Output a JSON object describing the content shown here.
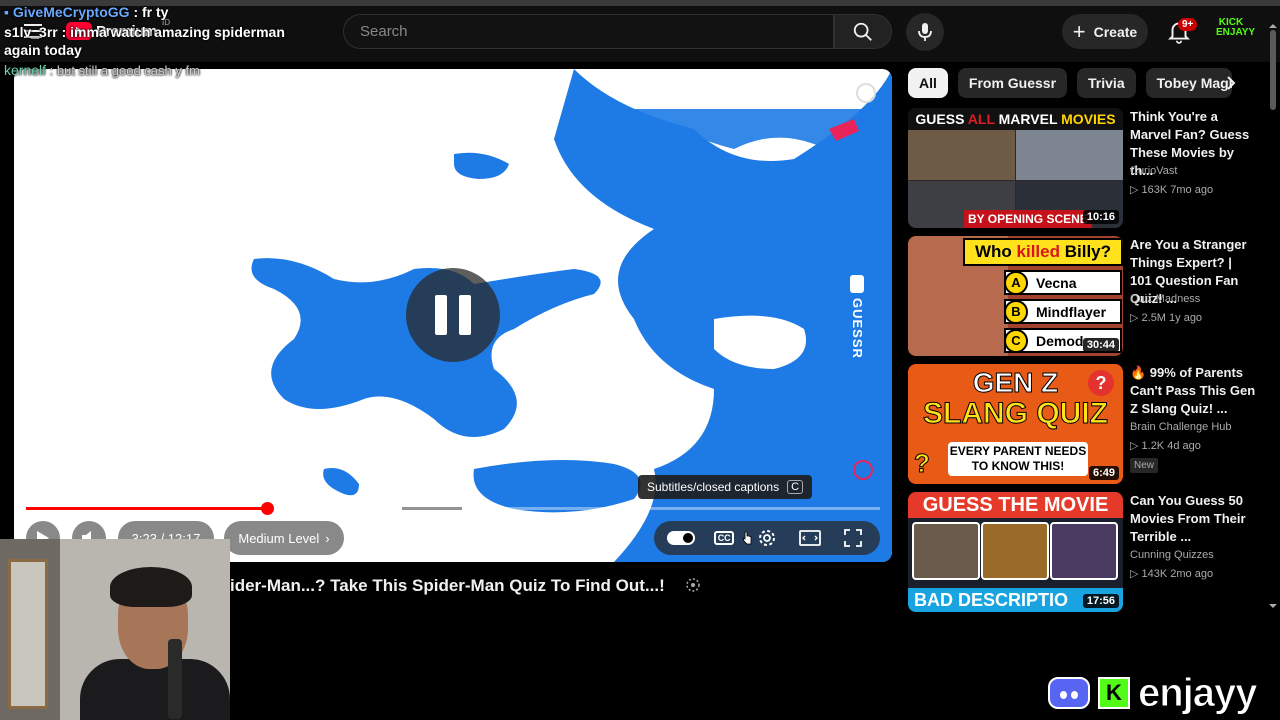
{
  "header": {
    "logo_text": "Premium",
    "logo_sup": "ID",
    "search_placeholder": "Search",
    "create_label": "Create",
    "notification_count": "9+",
    "avatar_text": "KICK\nENJAYY"
  },
  "chat": {
    "messages": [
      {
        "user": "GiveMeCryptoGG",
        "text": " : fr ty"
      },
      {
        "user": "s1lv_3rr",
        "text": " : imma watch amazing spiderman again today"
      },
      {
        "user": "kernelf",
        "text": " : but still a good cash y fm"
      }
    ]
  },
  "player": {
    "watermark_text": "GUESSR",
    "tooltip_text": "Subtitles/closed captions",
    "tooltip_key": "C",
    "time_display": "3:23 / 12:17",
    "chapter_label": "Medium Level",
    "cc_label": "CC",
    "progress_played": 0.282,
    "progress_loaded_start": 0.44,
    "progress_loaded_end": 0.51,
    "accent_color": "#ff0000"
  },
  "video": {
    "title": "ider-Man...? Take This Spider-Man Quiz To Find Out...!"
  },
  "chips": [
    "All",
    "From Guessr",
    "Trivia",
    "Tobey Maguire"
  ],
  "recommendations": [
    {
      "title": "Think You're a Marvel Fan? Guess These Movies by th...",
      "channel": "CurioVast",
      "meta": "▷ 163K  7mo ago",
      "duration": "10:16",
      "thumb_band_a": "GUESS ",
      "thumb_band_b": "ALL ",
      "thumb_band_c": "MARVEL ",
      "thumb_band_d": "MOVIES",
      "thumb_scene": "BY OPENING SCENE"
    },
    {
      "title": "Are You a Stranger Things Expert? | 101 Question Fan Quiz! ...",
      "channel": "Quiz Madness",
      "meta": "▷ 2.5M  1y ago",
      "duration": "30:44",
      "thumb_head_a": "Who ",
      "thumb_head_b": "killed ",
      "thumb_head_c": "Billy?",
      "options": [
        {
          "letter": "A",
          "text": "Vecna"
        },
        {
          "letter": "B",
          "text": "Mindflayer"
        },
        {
          "letter": "C",
          "text": "Demod"
        }
      ]
    },
    {
      "title": "🔥 99% of Parents Can't Pass This Gen Z Slang Quiz! ...",
      "channel": "Brain Challenge Hub",
      "meta": "▷ 1.2K  4d ago",
      "badge": "New",
      "duration": "6:49",
      "thumb_line1": "GEN Z",
      "thumb_line2": "SLANG QUIZ",
      "thumb_line3": "EVERY PARENT NEEDS TO KNOW THIS!",
      "thumb_q": "?"
    },
    {
      "title": "Can You Guess 50 Movies From Their Terrible ...",
      "channel": "Cunning Quizzes",
      "meta": "▷ 143K  2mo ago",
      "duration": "17:56",
      "thumb_top": "GUESS THE MOVIE",
      "thumb_bottom": "BAD DESCRIPTIO"
    }
  ],
  "stream_overlay": {
    "brand_text": "enjayy",
    "kick_letter": "K"
  }
}
